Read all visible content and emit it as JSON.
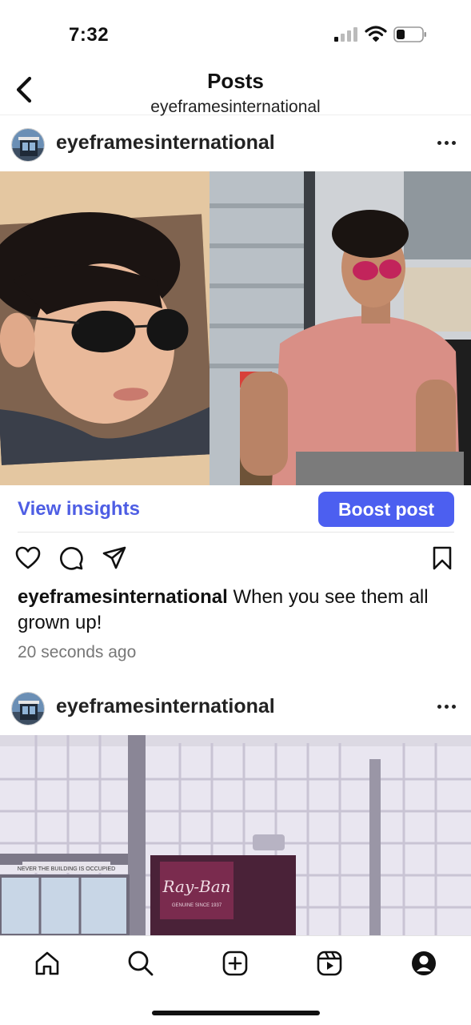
{
  "status_bar": {
    "time": "7:32"
  },
  "header": {
    "title": "Posts",
    "subtitle": "eyeframesinternational"
  },
  "posts": [
    {
      "username": "eyeframesinternational",
      "view_insights_label": "View insights",
      "boost_label": "Boost post",
      "caption_user": "eyeframesinternational",
      "caption_text": " When you see them all grown up!",
      "timestamp": "20 seconds ago"
    },
    {
      "username": "eyeframesinternational",
      "image_text": {
        "brand": "Ray-Ban",
        "brand_tagline": "GENUINE SINCE 1937",
        "banner": "NEVER THE BUILDING IS OCCUPIED"
      }
    }
  ],
  "icons": {
    "back": "chevron-left-icon",
    "more": "more-horizontal-icon",
    "like": "heart-icon",
    "comment": "comment-icon",
    "share": "send-icon",
    "save": "bookmark-icon",
    "home": "home-icon",
    "search": "search-icon",
    "create": "plus-square-icon",
    "reels": "reels-icon",
    "profile": "profile-icon"
  },
  "colors": {
    "accent": "#4c5ff0",
    "link": "#4e5ee4"
  }
}
